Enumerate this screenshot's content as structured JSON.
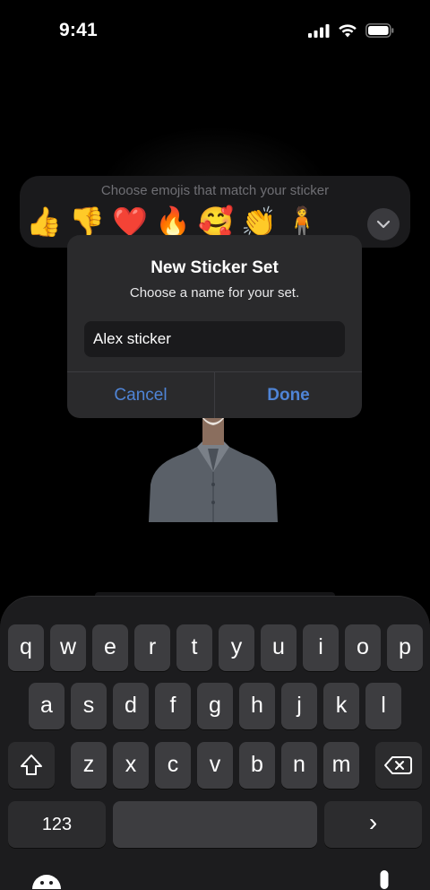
{
  "status_bar": {
    "time": "9:41"
  },
  "emoji_picker": {
    "hint": "Choose emojis that match your sticker",
    "emojis": [
      "👍",
      "👎",
      "❤️",
      "🔥",
      "🥰",
      "👏",
      "🧍"
    ]
  },
  "dialog": {
    "title": "New Sticker Set",
    "subtitle": "Choose a name for your set.",
    "input_value": "Alex sticker",
    "cancel_label": "Cancel",
    "done_label": "Done"
  },
  "keyboard": {
    "row1": [
      "q",
      "w",
      "e",
      "r",
      "t",
      "y",
      "u",
      "i",
      "o",
      "p"
    ],
    "row2": [
      "a",
      "s",
      "d",
      "f",
      "g",
      "h",
      "j",
      "k",
      "l"
    ],
    "row3": [
      "z",
      "x",
      "c",
      "v",
      "b",
      "n",
      "m"
    ],
    "numbers_label": "123",
    "return_label": "›"
  },
  "colors": {
    "accent": "#4f84d6",
    "dialog_bg": "#2a2a2c",
    "key_bg": "#3d3d40"
  }
}
